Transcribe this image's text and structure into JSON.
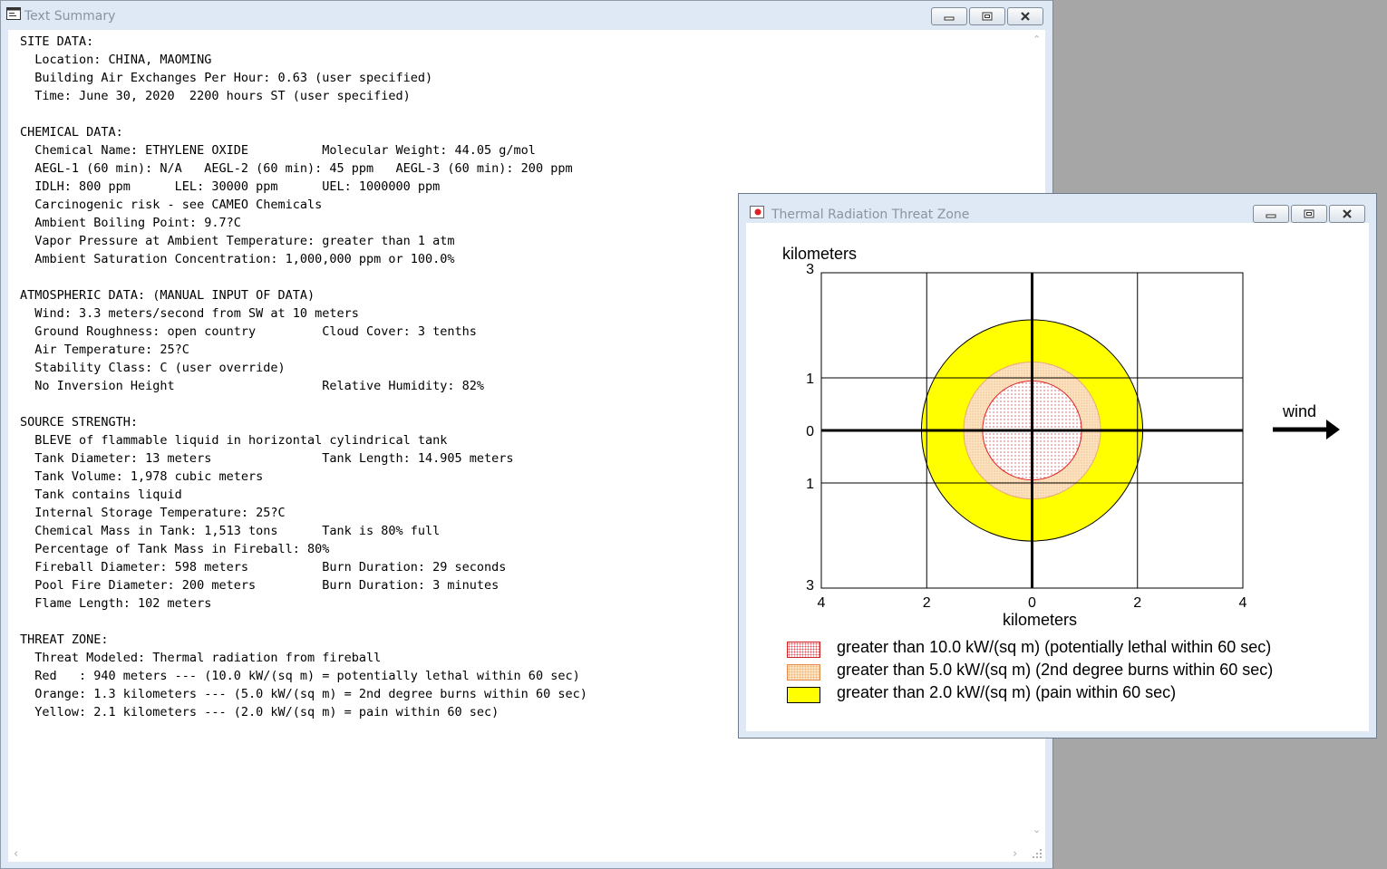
{
  "summary_window": {
    "title": "Text Summary",
    "text": [
      "SITE DATA:",
      "  Location: CHINA, MAOMING",
      "  Building Air Exchanges Per Hour: 0.63 (user specified)",
      "  Time: June 30, 2020  2200 hours ST (user specified)",
      "",
      "CHEMICAL DATA:",
      "  Chemical Name: ETHYLENE OXIDE          Molecular Weight: 44.05 g/mol",
      "  AEGL-1 (60 min): N/A   AEGL-2 (60 min): 45 ppm   AEGL-3 (60 min): 200 ppm",
      "  IDLH: 800 ppm      LEL: 30000 ppm      UEL: 1000000 ppm",
      "  Carcinogenic risk - see CAMEO Chemicals",
      "  Ambient Boiling Point: 9.7?C",
      "  Vapor Pressure at Ambient Temperature: greater than 1 atm",
      "  Ambient Saturation Concentration: 1,000,000 ppm or 100.0%",
      "",
      "ATMOSPHERIC DATA: (MANUAL INPUT OF DATA)",
      "  Wind: 3.3 meters/second from SW at 10 meters",
      "  Ground Roughness: open country         Cloud Cover: 3 tenths",
      "  Air Temperature: 25?C",
      "  Stability Class: C (user override)",
      "  No Inversion Height                    Relative Humidity: 82%",
      "",
      "SOURCE STRENGTH:",
      "  BLEVE of flammable liquid in horizontal cylindrical tank",
      "  Tank Diameter: 13 meters               Tank Length: 14.905 meters",
      "  Tank Volume: 1,978 cubic meters",
      "  Tank contains liquid",
      "  Internal Storage Temperature: 25?C",
      "  Chemical Mass in Tank: 1,513 tons      Tank is 80% full",
      "  Percentage of Tank Mass in Fireball: 80%",
      "  Fireball Diameter: 598 meters          Burn Duration: 29 seconds",
      "  Pool Fire Diameter: 200 meters         Burn Duration: 3 minutes",
      "  Flame Length: 102 meters",
      "",
      "THREAT ZONE:",
      "  Threat Modeled: Thermal radiation from fireball",
      "  Red   : 940 meters --- (10.0 kW/(sq m) = potentially lethal within 60 sec)",
      "  Orange: 1.3 kilometers --- (5.0 kW/(sq m) = 2nd degree burns within 60 sec)",
      "  Yellow: 2.1 kilometers --- (2.0 kW/(sq m) = pain within 60 sec)"
    ]
  },
  "threat_window": {
    "title": "Thermal Radiation Threat Zone",
    "wind_label": "wind",
    "legend": [
      {
        "label": "greater than 10.0 kW/(sq m) (potentially lethal within 60 sec)",
        "style": "red"
      },
      {
        "label": "greater than 5.0 kW/(sq m) (2nd degree burns within 60 sec)",
        "style": "orange"
      },
      {
        "label": "greater than 2.0 kW/(sq m) (pain within 60 sec)",
        "style": "yellow"
      }
    ]
  },
  "chart_data": {
    "type": "threat-zone-plot",
    "xlabel": "kilometers",
    "ylabel": "kilometers",
    "xlim": [
      -4,
      4
    ],
    "ylim": [
      -3,
      3
    ],
    "x_ticks": [
      {
        "value": -4,
        "label": "4"
      },
      {
        "value": -2,
        "label": "2"
      },
      {
        "value": 0,
        "label": "0"
      },
      {
        "value": 2,
        "label": "2"
      },
      {
        "value": 4,
        "label": "4"
      }
    ],
    "y_ticks": [
      {
        "value": 3,
        "label": "3"
      },
      {
        "value": 1,
        "label": "1"
      },
      {
        "value": 0,
        "label": "0"
      },
      {
        "value": -1,
        "label": "1"
      },
      {
        "value": -3,
        "label": "3"
      }
    ],
    "zones": [
      {
        "name": "yellow",
        "radius_km": 2.1,
        "fill": "#ffff00",
        "stroke": "#000000"
      },
      {
        "name": "orange",
        "radius_km": 1.3,
        "fill": "#fbe0bd",
        "stroke": "#e8a878"
      },
      {
        "name": "red",
        "radius_km": 0.94,
        "fill": "#ffffff",
        "stroke": "#e02020"
      }
    ],
    "grid": true
  }
}
